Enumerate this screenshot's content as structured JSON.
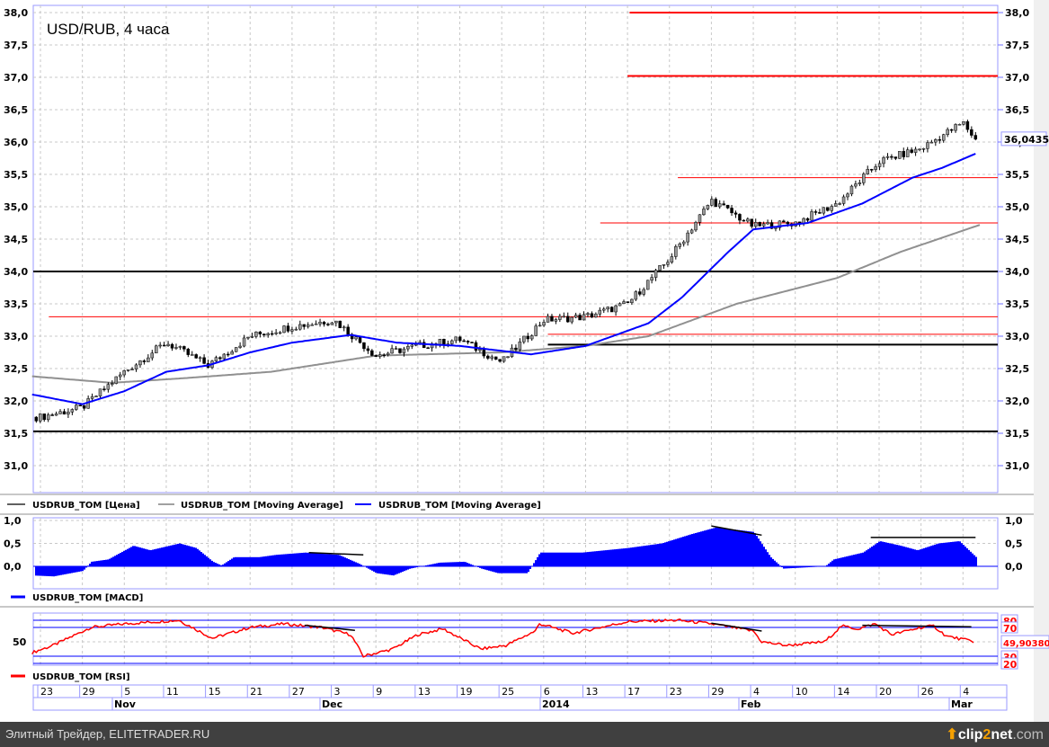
{
  "title": "USD/RUB, 4 часа",
  "legend": {
    "price": "USDRUB_TOM [Цена]",
    "ma_slow": "USDRUB_TOM [Moving Average]",
    "ma_fast": "USDRUB_TOM [Moving Average]",
    "macd": "USDRUB_TOM [MACD]",
    "rsi": "USDRUB_TOM [RSI]"
  },
  "last_price_label": "36,0435",
  "last_rsi_label": "49,90380",
  "footer": {
    "text": "Элитный Трейдер, ELITETRADER.RU",
    "logo_a": "clip",
    "logo_b": "2",
    "logo_c": "net",
    "logo_d": ".com"
  },
  "colors": {
    "price": "#000000",
    "ma_fast": "#0000ff",
    "ma_slow": "#909090",
    "level_red": "#ff0000",
    "macd": "#0000ff",
    "rsi": "#ff0000",
    "footer_bg": "#404040"
  },
  "chart_data": [
    {
      "type": "line",
      "title": "USD/RUB, 4 часа",
      "ylim": [
        30.6,
        38.1
      ],
      "yticks": [
        "38,0",
        "37,5",
        "37,0",
        "36,5",
        "36,0",
        "35,5",
        "35,0",
        "34,5",
        "34,0",
        "33,5",
        "33,0",
        "32,5",
        "32,0",
        "31,5",
        "31,0"
      ],
      "ytick_values": [
        38,
        37.5,
        37,
        36.5,
        36,
        35.5,
        35,
        34.5,
        34,
        33.5,
        33,
        32.5,
        32,
        31.5,
        31
      ],
      "xlabels": [
        "23",
        "29",
        "5",
        "11",
        "15",
        "21",
        "27",
        "3",
        "9",
        "13",
        "19",
        "25",
        "6",
        "13",
        "17",
        "23",
        "29",
        "4",
        "10",
        "14",
        "20",
        "26",
        "4"
      ],
      "months": [
        {
          "label": "Nov",
          "at": 2
        },
        {
          "label": "Dec",
          "at": 7
        },
        {
          "label": "2014",
          "at": 12
        },
        {
          "label": "Feb",
          "at": 17
        },
        {
          "label": "Mar",
          "at": 22
        }
      ],
      "x_range": [
        -0.2,
        23.2
      ],
      "price_waypoints": [
        [
          0,
          31.75
        ],
        [
          1,
          31.9
        ],
        [
          2,
          32.45
        ],
        [
          3,
          32.9
        ],
        [
          4,
          32.55
        ],
        [
          5,
          33.0
        ],
        [
          6,
          33.15
        ],
        [
          7,
          33.25
        ],
        [
          8,
          32.7
        ],
        [
          9,
          32.85
        ],
        [
          10,
          32.95
        ],
        [
          11,
          32.6
        ],
        [
          12,
          33.25
        ],
        [
          13,
          33.3
        ],
        [
          14,
          33.5
        ],
        [
          15,
          34.2
        ],
        [
          16,
          35.1
        ],
        [
          17,
          34.7
        ],
        [
          18,
          34.75
        ],
        [
          19,
          35.05
        ],
        [
          20,
          35.7
        ],
        [
          21,
          35.9
        ],
        [
          22,
          36.3
        ],
        [
          22.3,
          36.04
        ]
      ],
      "ma_fast": [
        [
          -0.2,
          32.1
        ],
        [
          1,
          31.95
        ],
        [
          2,
          32.15
        ],
        [
          3,
          32.45
        ],
        [
          4,
          32.55
        ],
        [
          5,
          32.75
        ],
        [
          6,
          32.9
        ],
        [
          7.4,
          33.02
        ],
        [
          8.5,
          32.9
        ],
        [
          10,
          32.85
        ],
        [
          11.7,
          32.72
        ],
        [
          13,
          32.85
        ],
        [
          14.5,
          33.2
        ],
        [
          15.3,
          33.6
        ],
        [
          16.4,
          34.3
        ],
        [
          17,
          34.65
        ],
        [
          18.3,
          34.75
        ],
        [
          19.6,
          35.05
        ],
        [
          20.8,
          35.45
        ],
        [
          21.5,
          35.6
        ],
        [
          22.3,
          35.82
        ]
      ],
      "ma_slow": [
        [
          -0.2,
          32.38
        ],
        [
          1.7,
          32.28
        ],
        [
          3.4,
          32.35
        ],
        [
          5.5,
          32.45
        ],
        [
          8,
          32.7
        ],
        [
          11,
          32.75
        ],
        [
          13,
          32.85
        ],
        [
          14.5,
          33.0
        ],
        [
          16.6,
          33.5
        ],
        [
          19,
          33.9
        ],
        [
          20.5,
          34.3
        ],
        [
          22.4,
          34.72
        ]
      ],
      "levels": [
        {
          "value": 38.0,
          "from": 14.05,
          "color": "red",
          "bold": true
        },
        {
          "value": 37.02,
          "from": 14.0,
          "color": "red",
          "bold": true
        },
        {
          "value": 35.45,
          "from": 15.2,
          "color": "red",
          "bold": false
        },
        {
          "value": 34.75,
          "from": 13.35,
          "color": "red",
          "bold": false
        },
        {
          "value": 33.3,
          "from": 0.2,
          "color": "red",
          "bold": false
        },
        {
          "value": 33.03,
          "from": 12.1,
          "color": "red",
          "bold": false
        },
        {
          "value": 34.0,
          "from": -0.2,
          "color": "black",
          "bold": true
        },
        {
          "value": 32.87,
          "from": 12.1,
          "color": "black",
          "bold": true
        },
        {
          "value": 31.53,
          "from": -0.2,
          "color": "black",
          "bold": true
        }
      ],
      "last": 36.0435
    },
    {
      "type": "bar",
      "title": "MACD",
      "ylim": [
        -0.35,
        1.0
      ],
      "yticks": [
        "1,0",
        "0,5",
        "0,0"
      ],
      "ytick_values": [
        1,
        0.5,
        0
      ],
      "waypoints": [
        [
          -0.2,
          -0.2
        ],
        [
          0.3,
          -0.22
        ],
        [
          1,
          -0.1
        ],
        [
          1.2,
          0.1
        ],
        [
          1.6,
          0.15
        ],
        [
          2,
          0.35
        ],
        [
          2.2,
          0.45
        ],
        [
          2.6,
          0.35
        ],
        [
          3.3,
          0.5
        ],
        [
          3.7,
          0.4
        ],
        [
          4.1,
          0.1
        ],
        [
          4.3,
          0.02
        ],
        [
          4.6,
          0.2
        ],
        [
          5.2,
          0.2
        ],
        [
          5.6,
          0.25
        ],
        [
          6.3,
          0.3
        ],
        [
          7.1,
          0.25
        ],
        [
          7.6,
          0.05
        ],
        [
          8,
          -0.15
        ],
        [
          8.4,
          -0.2
        ],
        [
          8.8,
          -0.05
        ],
        [
          9.5,
          0.08
        ],
        [
          10.1,
          0.1
        ],
        [
          10.5,
          -0.05
        ],
        [
          10.9,
          -0.15
        ],
        [
          11.6,
          -0.15
        ],
        [
          11.9,
          0.3
        ],
        [
          12.9,
          0.3
        ],
        [
          14,
          0.4
        ],
        [
          14.8,
          0.5
        ],
        [
          15.5,
          0.7
        ],
        [
          16.1,
          0.85
        ],
        [
          17,
          0.75
        ],
        [
          17.4,
          0.2
        ],
        [
          17.7,
          -0.05
        ],
        [
          18.7,
          0
        ],
        [
          18.9,
          0.15
        ],
        [
          19.6,
          0.3
        ],
        [
          20,
          0.55
        ],
        [
          20.5,
          0.45
        ],
        [
          20.9,
          0.35
        ],
        [
          21.4,
          0.5
        ],
        [
          21.9,
          0.55
        ],
        [
          22.3,
          0.2
        ]
      ],
      "trendlines": [
        [
          [
            6.4,
            0.3
          ],
          [
            7.7,
            0.25
          ]
        ],
        [
          [
            16,
            0.88
          ],
          [
            17.2,
            0.68
          ]
        ],
        [
          [
            19.8,
            0.63
          ],
          [
            22.3,
            0.63
          ]
        ]
      ]
    },
    {
      "type": "line",
      "title": "RSI",
      "ylim": [
        15,
        90
      ],
      "yticks": [
        "80",
        "70",
        "30",
        "20"
      ],
      "ytick_values": [
        80,
        70,
        30,
        20
      ],
      "waypoints": [
        [
          -0.2,
          35
        ],
        [
          0.3,
          45
        ],
        [
          1.2,
          70
        ],
        [
          2,
          75
        ],
        [
          3.3,
          80
        ],
        [
          4.1,
          55
        ],
        [
          5,
          70
        ],
        [
          5.8,
          75
        ],
        [
          6.7,
          70
        ],
        [
          7.4,
          60
        ],
        [
          7.7,
          30
        ],
        [
          8.4,
          40
        ],
        [
          9,
          60
        ],
        [
          9.6,
          68
        ],
        [
          10.5,
          40
        ],
        [
          11.1,
          45
        ],
        [
          11.8,
          65
        ],
        [
          11.9,
          75
        ],
        [
          12.7,
          62
        ],
        [
          14,
          78
        ],
        [
          15.2,
          80
        ],
        [
          16,
          75
        ],
        [
          17,
          65
        ],
        [
          17.2,
          50
        ],
        [
          17.8,
          45
        ],
        [
          18.7,
          50
        ],
        [
          19.1,
          72
        ],
        [
          19.5,
          68
        ],
        [
          19.9,
          75
        ],
        [
          20.3,
          60
        ],
        [
          21,
          70
        ],
        [
          21.3,
          72
        ],
        [
          21.6,
          58
        ],
        [
          22.3,
          50
        ]
      ],
      "trendlines": [
        [
          [
            6.3,
            73
          ],
          [
            7.5,
            66
          ]
        ],
        [
          [
            16,
            76
          ],
          [
            17.2,
            65
          ]
        ],
        [
          [
            19.6,
            73
          ],
          [
            22.2,
            71
          ]
        ]
      ],
      "last": 49.9038
    }
  ]
}
